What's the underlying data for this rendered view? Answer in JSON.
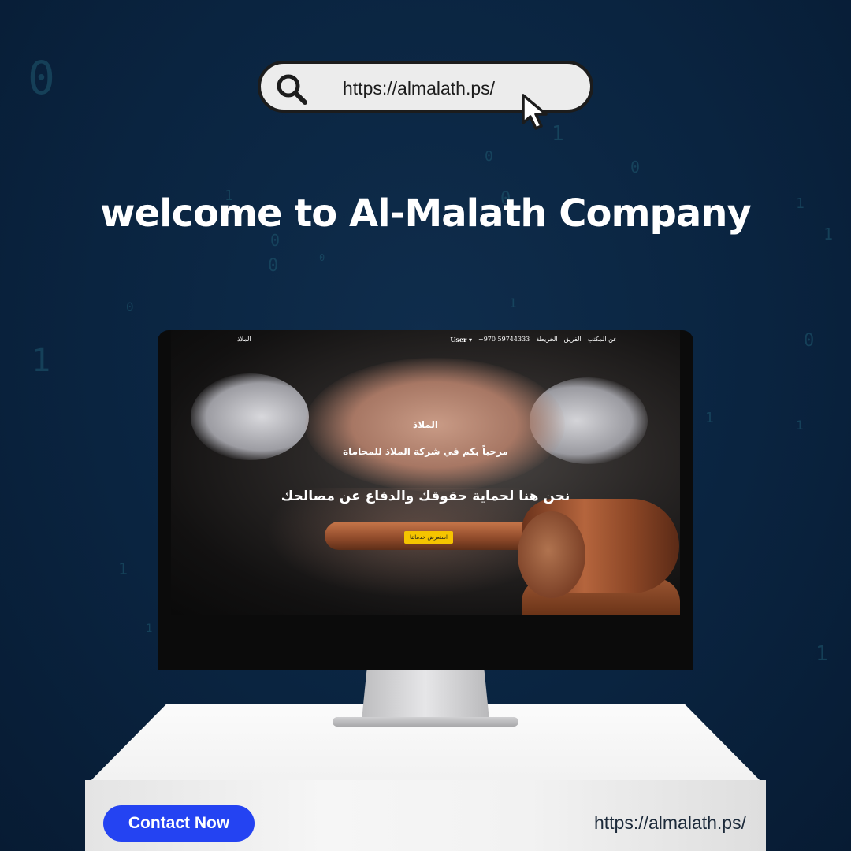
{
  "address_bar": {
    "url": "https://almalath.ps/",
    "icons": [
      "search-icon",
      "cursor-icon"
    ]
  },
  "headline": "welcome to Al-Malath Company",
  "website": {
    "nav": {
      "brand": "الملاذ",
      "links": [
        "عن المكتب",
        "الفريق",
        "الخريطة"
      ],
      "phone": "+970 59744333",
      "user_menu": "User ▾"
    },
    "hero": {
      "brand": "الملاذ",
      "welcome": "مرحباً بكم في شركة الملاذ للمحاماة",
      "tagline": "نحن هنا لحماية حقوقك والدفاع عن مصالحك",
      "cta_label": "استعرض خدماتنا"
    }
  },
  "footer": {
    "contact_label": "Contact Now",
    "url": "https://almalath.ps/"
  },
  "colors": {
    "background": "#0a2440",
    "contact_button": "#2443f2",
    "cta_button": "#f5c400"
  }
}
